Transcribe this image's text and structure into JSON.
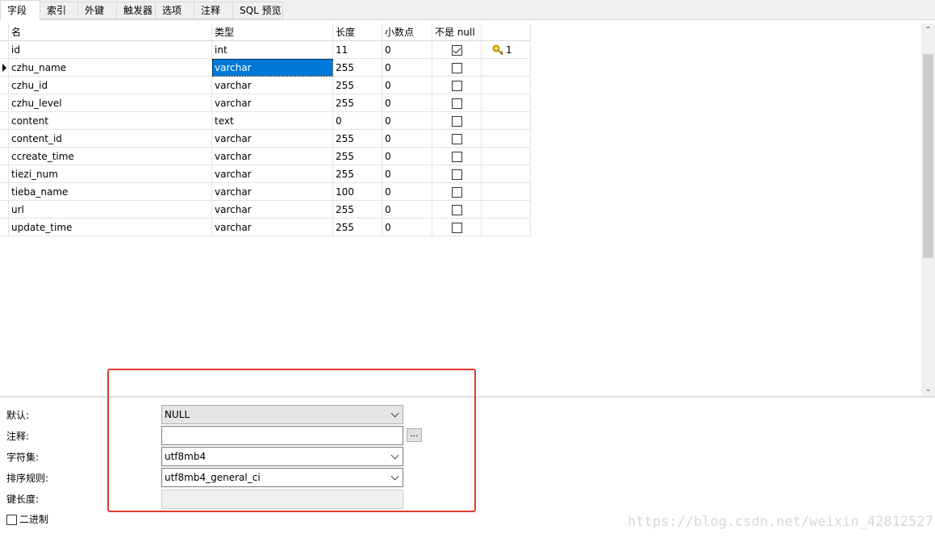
{
  "tabs": [
    {
      "label": "字段",
      "active": true
    },
    {
      "label": "索引",
      "active": false
    },
    {
      "label": "外键",
      "active": false
    },
    {
      "label": "触发器",
      "active": false
    },
    {
      "label": "选项",
      "active": false
    },
    {
      "label": "注释",
      "active": false
    },
    {
      "label": "SQL 预览",
      "active": false
    }
  ],
  "grid": {
    "columns": [
      "名",
      "类型",
      "长度",
      "小数点",
      "不是 null",
      ""
    ],
    "rows": [
      {
        "name": "id",
        "type": "int",
        "length": "11",
        "decimals": "0",
        "not_null": true,
        "key": "1"
      },
      {
        "name": "czhu_name",
        "type": "varchar",
        "length": "255",
        "decimals": "0",
        "not_null": false,
        "key": ""
      },
      {
        "name": "czhu_id",
        "type": "varchar",
        "length": "255",
        "decimals": "0",
        "not_null": false,
        "key": ""
      },
      {
        "name": "czhu_level",
        "type": "varchar",
        "length": "255",
        "decimals": "0",
        "not_null": false,
        "key": ""
      },
      {
        "name": "content",
        "type": "text",
        "length": "0",
        "decimals": "0",
        "not_null": false,
        "key": ""
      },
      {
        "name": "content_id",
        "type": "varchar",
        "length": "255",
        "decimals": "0",
        "not_null": false,
        "key": ""
      },
      {
        "name": "ccreate_time",
        "type": "varchar",
        "length": "255",
        "decimals": "0",
        "not_null": false,
        "key": ""
      },
      {
        "name": "tiezi_num",
        "type": "varchar",
        "length": "255",
        "decimals": "0",
        "not_null": false,
        "key": ""
      },
      {
        "name": "tieba_name",
        "type": "varchar",
        "length": "100",
        "decimals": "0",
        "not_null": false,
        "key": ""
      },
      {
        "name": "url",
        "type": "varchar",
        "length": "255",
        "decimals": "0",
        "not_null": false,
        "key": ""
      },
      {
        "name": "update_time",
        "type": "varchar",
        "length": "255",
        "decimals": "0",
        "not_null": false,
        "key": ""
      }
    ]
  },
  "properties": {
    "default_label": "默认:",
    "default_value": "NULL",
    "comment_label": "注释:",
    "comment_value": "",
    "ellipsis": "...",
    "charset_label": "字符集:",
    "charset_value": "utf8mb4",
    "collation_label": "排序规则:",
    "collation_value": "utf8mb4_general_ci",
    "key_length_label": "键长度:",
    "key_length_value": "",
    "binary_label": "二进制",
    "binary_checked": false
  },
  "colors": {
    "selection": "#0078d7",
    "annotation": "#e03a2f",
    "key_icon": "#e8b400"
  },
  "watermark": "https://blog.csdn.net/weixin_42812527"
}
